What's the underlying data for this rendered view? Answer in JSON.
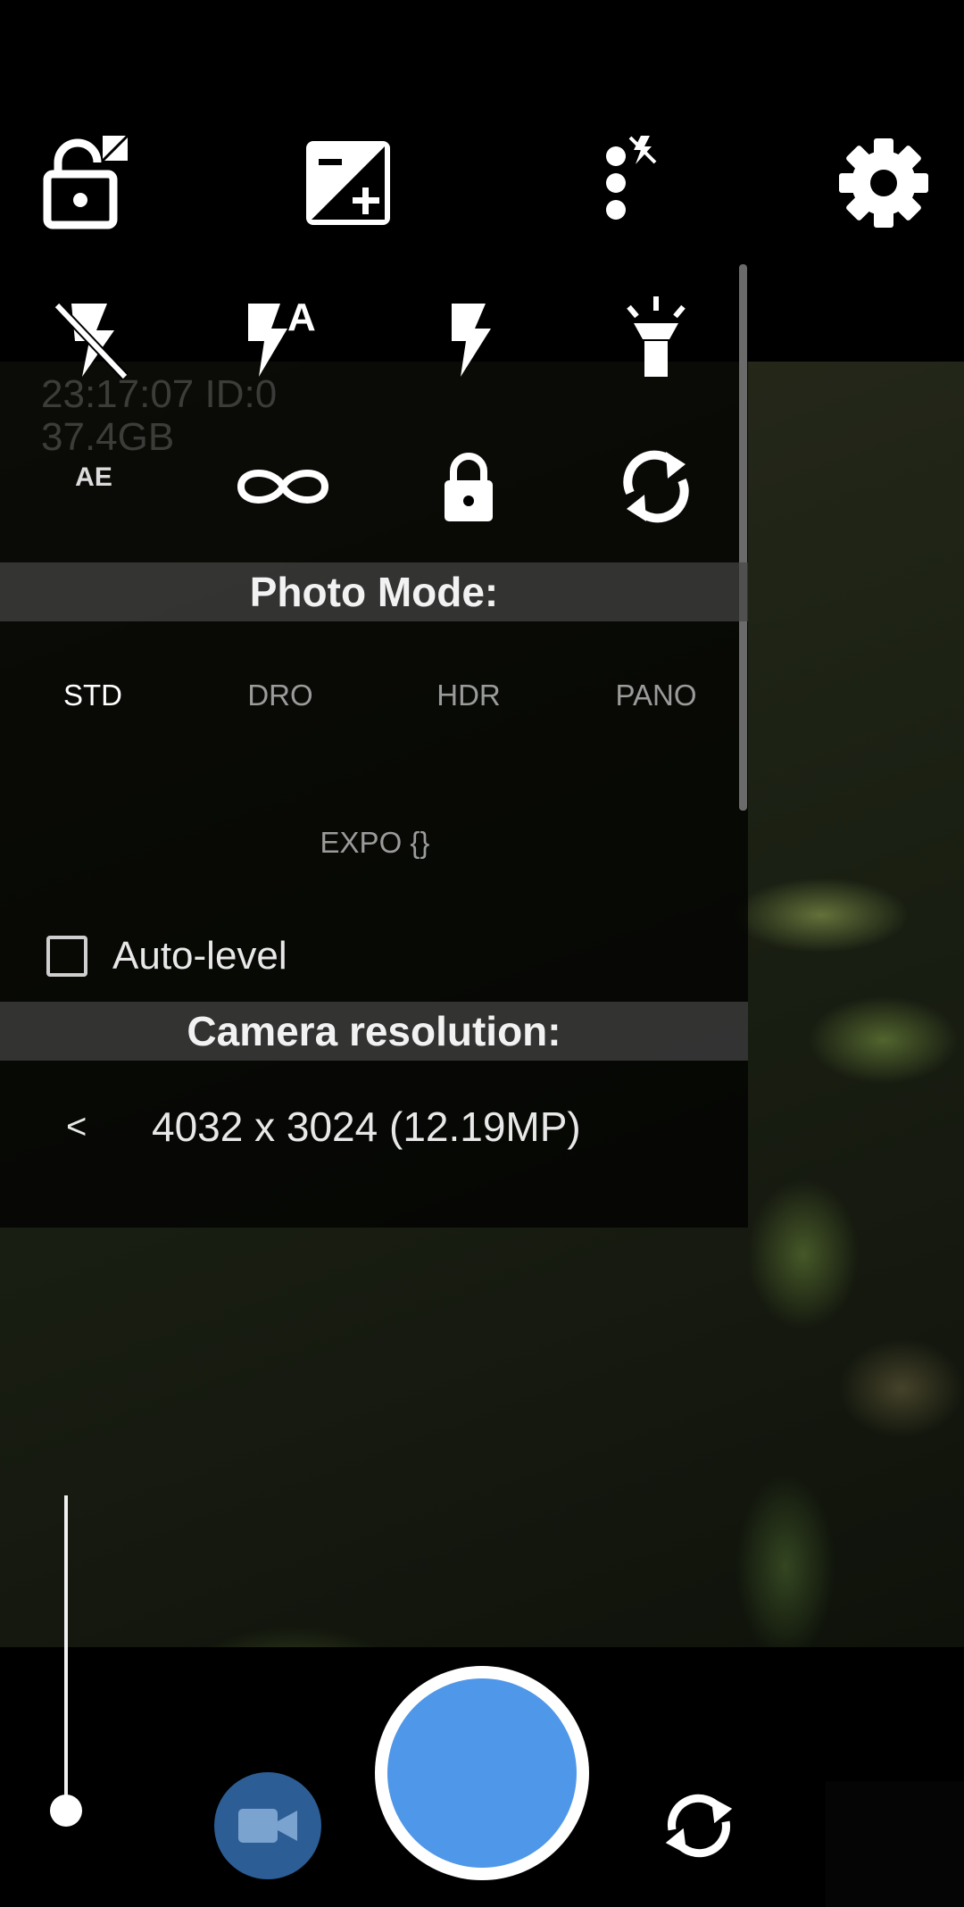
{
  "toolbar": {
    "icons": [
      "exposure-lock-icon",
      "exposure-compensation-icon",
      "more-options-icon",
      "settings-icon"
    ]
  },
  "popup": {
    "flash_options": [
      "flash-off-icon",
      "flash-auto-icon",
      "flash-on-icon",
      "torch-icon"
    ],
    "lock_options": {
      "ae_label": "AE",
      "icons": [
        "continuous-focus-icon",
        "lock-icon",
        "refresh-icon"
      ]
    },
    "photo_mode": {
      "header": "Photo Mode:",
      "modes": [
        "STD",
        "DRO",
        "HDR",
        "PANO",
        "EXPO {}"
      ],
      "selected": "STD"
    },
    "auto_level": {
      "label": "Auto-level",
      "checked": false
    },
    "camera_resolution": {
      "header": "Camera resolution:",
      "prev_label": "<",
      "value": "4032 x 3024 (12.19MP)"
    }
  },
  "overlay": {
    "time_line": "23:17:07 ID:0",
    "storage_line": "37.4GB"
  },
  "bottom": {
    "zoom_level": 0,
    "icons": [
      "video-camera-icon",
      "shutter",
      "switch-camera-icon"
    ]
  },
  "colors": {
    "shutter_inner": "#4f97e8",
    "video_button": "#2c5d95",
    "panel_header": "#464646"
  }
}
